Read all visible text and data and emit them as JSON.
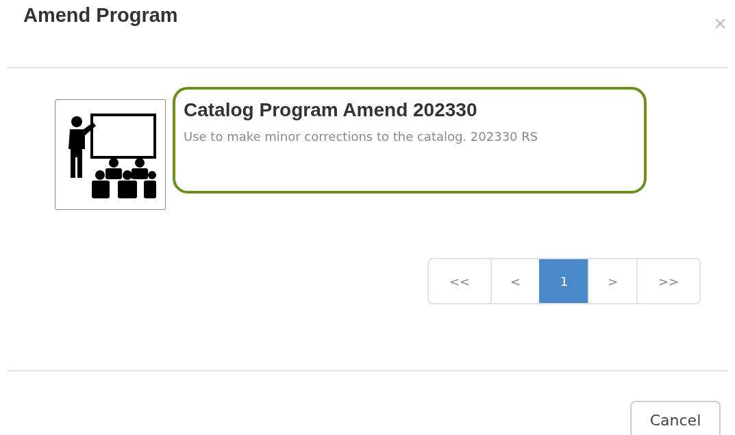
{
  "dialog": {
    "title": "Amend Program",
    "close": "×"
  },
  "programs": [
    {
      "title": "Catalog Program Amend 202330",
      "description": "Use to make minor corrections to the catalog. 202330 RS",
      "selected": true
    }
  ],
  "pagination": [
    {
      "label": "<<",
      "selected": false
    },
    {
      "label": "<",
      "selected": false
    },
    {
      "label": "1",
      "selected": true
    },
    {
      "label": ">",
      "selected": false
    },
    {
      "label": ">>",
      "selected": false
    }
  ],
  "buttons": [
    "Cancel"
  ]
}
